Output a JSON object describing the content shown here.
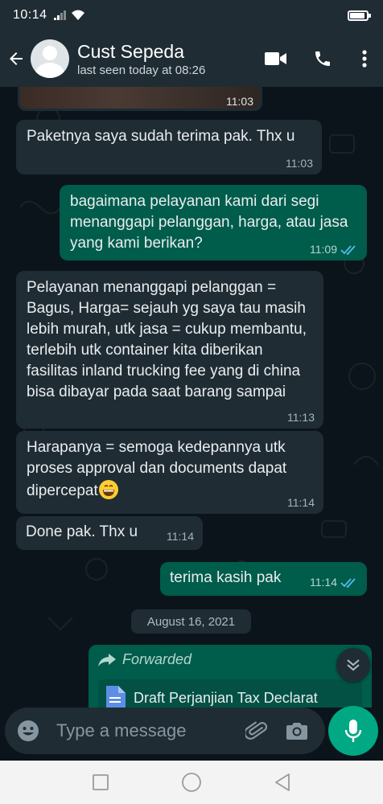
{
  "status_bar": {
    "time": "10:14",
    "battery_level": 0.8
  },
  "header": {
    "contact_name": "Cust Sepeda",
    "last_seen": "last seen today at 08:26",
    "icons": [
      "back-arrow-icon",
      "video-call-icon",
      "voice-call-icon",
      "more-menu-icon"
    ]
  },
  "messages": [
    {
      "direction": "in",
      "type": "image",
      "time": "11:03"
    },
    {
      "direction": "in",
      "text": "Paketnya saya sudah terima pak. Thx u",
      "time": "11:03"
    },
    {
      "direction": "out",
      "text": "bagaimana pelayanan kami dari segi menanggapi pelanggan, harga, atau jasa yang kami berikan?",
      "time": "11:09",
      "status": "read"
    },
    {
      "direction": "in",
      "text": "Pelayanan menanggapi pelanggan = Bagus, Harga= sejauh yg saya tau masih lebih murah, utk jasa = cukup membantu, terlebih utk container kita diberikan fasilitas inland trucking fee yang di china bisa dibayar pada saat barang sampai",
      "time": "11:13"
    },
    {
      "direction": "in",
      "text": "Harapanya = semoga kedepannya utk proses approval dan documents dapat dipercepat",
      "emoji": "grinning-face",
      "time": "11:14"
    },
    {
      "direction": "in",
      "text": "Done pak. Thx u",
      "time": "11:14"
    },
    {
      "direction": "out",
      "text": "terima kasih pak",
      "time": "11:14",
      "status": "read"
    }
  ],
  "date_separator": "August 16, 2021",
  "forwarded": {
    "label": "Forwarded",
    "doc_title": "Draft Perjanjian Tax Declarat"
  },
  "composer": {
    "placeholder": "Type a message"
  },
  "colors": {
    "header": "#1f2c34",
    "incoming": "#1f2c34",
    "outgoing": "#005c4b",
    "accent": "#00a884",
    "read_ticks": "#53bdeb"
  }
}
